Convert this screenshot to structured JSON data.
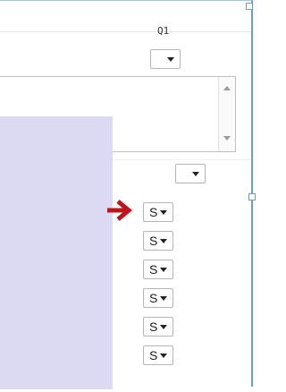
{
  "header": {
    "column_label": "Q1"
  },
  "row_selects": {
    "blank_value": "",
    "values": [
      "S",
      "S",
      "S",
      "S",
      "S",
      "S"
    ]
  },
  "colors": {
    "frame_border": "#6f9cc9",
    "side_panel": "#dcd9f2",
    "arrow": "#c0141b"
  },
  "icons": {
    "dropdown": "chevron-down-icon",
    "scroll_up": "scroll-up-icon",
    "scroll_down": "scroll-down-icon",
    "arrow": "arrow-right-icon"
  }
}
